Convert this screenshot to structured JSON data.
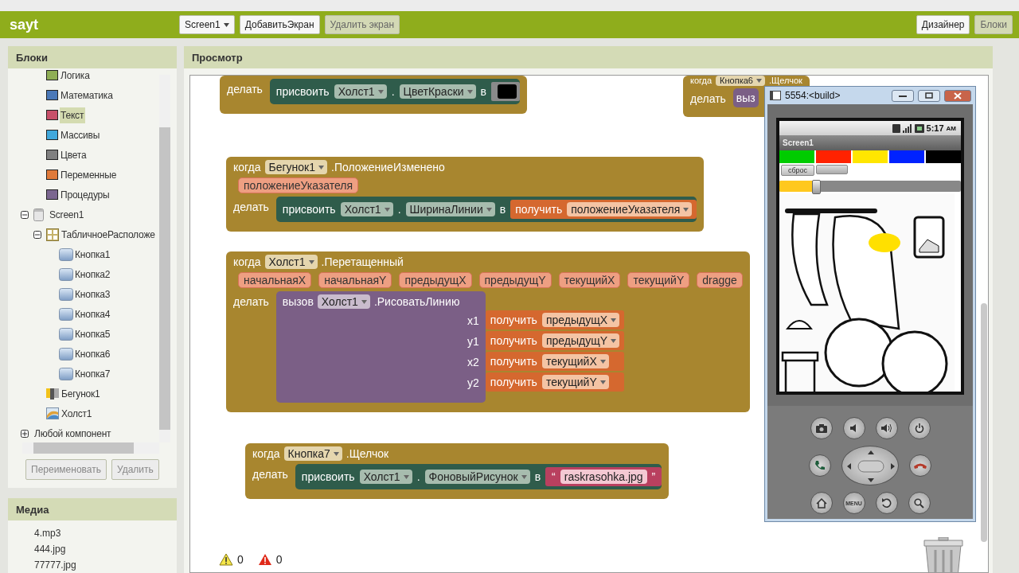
{
  "app_bar": {
    "title": "sayt",
    "screen_dropdown": "Screen1",
    "buttons": [
      {
        "label": "ДобавитьЭкран",
        "disabled": false
      },
      {
        "label": "Удалить экран",
        "disabled": true
      }
    ],
    "view_tabs": [
      {
        "label": "Дизайнер",
        "selected": false
      },
      {
        "label": "Блоки",
        "selected": true
      }
    ]
  },
  "blocks_panel": {
    "title": "Блоки",
    "tree": [
      {
        "kind": "builtin",
        "label": "Логика",
        "color": "#8fae55",
        "selected": false
      },
      {
        "kind": "builtin",
        "label": "Математика",
        "color": "#4a78b8",
        "selected": false
      },
      {
        "kind": "builtin",
        "label": "Текст",
        "color": "#c8506a",
        "selected": true
      },
      {
        "kind": "builtin",
        "label": "Массивы",
        "color": "#40a8dc",
        "selected": false
      },
      {
        "kind": "builtin",
        "label": "Цвета",
        "color": "#808080",
        "selected": false
      },
      {
        "kind": "builtin",
        "label": "Переменные",
        "color": "#e07a3a",
        "selected": false
      },
      {
        "kind": "builtin",
        "label": "Процедуры",
        "color": "#7b6690",
        "selected": false
      },
      {
        "kind": "screen",
        "label": "Screen1",
        "selected": false,
        "expanded": true,
        "children": [
          {
            "kind": "table",
            "label": "ТабличноеРасположе",
            "selected": false,
            "expanded": true,
            "children": [
              {
                "kind": "button",
                "label": "Кнопка1",
                "selected": false
              },
              {
                "kind": "button",
                "label": "Кнопка2",
                "selected": false
              },
              {
                "kind": "button",
                "label": "Кнопка3",
                "selected": false
              },
              {
                "kind": "button",
                "label": "Кнопка4",
                "selected": false
              },
              {
                "kind": "button",
                "label": "Кнопка5",
                "selected": false
              },
              {
                "kind": "button",
                "label": "Кнопка6",
                "selected": false
              },
              {
                "kind": "button",
                "label": "Кнопка7",
                "selected": false
              }
            ]
          },
          {
            "kind": "slider",
            "label": "Бегунок1",
            "selected": false
          },
          {
            "kind": "canvas",
            "label": "Холст1",
            "selected": false
          }
        ]
      },
      {
        "kind": "any",
        "label": "Любой компонент",
        "selected": false,
        "expanded": false
      }
    ],
    "buttons": [
      {
        "label": "Переименовать",
        "disabled": true
      },
      {
        "label": "Удалить",
        "disabled": true
      }
    ]
  },
  "media_panel": {
    "title": "Медиа",
    "files": [
      "4.mp3",
      "444.jpg",
      "77777.jpg"
    ]
  },
  "viewer": {
    "title": "Просмотр",
    "blocks": [
      {
        "kind": "event",
        "do": "делать",
        "statement": {
          "kind": "set",
          "verb": "присвоить",
          "component": "Холст1",
          "dot": ".",
          "property": "ЦветКраски",
          "to": "в",
          "value": {
            "kind": "color",
            "color": "#000000"
          }
        }
      },
      {
        "kind": "event",
        "when": "когда",
        "component": "Кнопка6",
        "event": ".Щелчок",
        "do": "делать",
        "statement": {
          "kind": "call",
          "verb": "выз"
        }
      },
      {
        "kind": "event",
        "when": "когда",
        "component": "Бегунок1",
        "event": ".ПоложениеИзменено",
        "params": [
          "положениеУказателя"
        ],
        "do": "делать",
        "statement": {
          "kind": "set",
          "verb": "присвоить",
          "component": "Холст1",
          "dot": ".",
          "property": "ШиринаЛинии",
          "to": "в",
          "value": {
            "kind": "get",
            "verb": "получить",
            "name": "положениеУказателя"
          }
        }
      },
      {
        "kind": "event",
        "when": "когда",
        "component": "Холст1",
        "event": ".Перетащенный",
        "params": [
          "начальнаяX",
          "начальнаяY",
          "предыдущX",
          "предыдущY",
          "текущийX",
          "текущийY",
          "dragge"
        ],
        "do": "делать",
        "statement": {
          "kind": "call",
          "verb": "вызов",
          "component": "Холст1",
          "method": ".РисоватьЛинию",
          "args": [
            {
              "name": "x1",
              "value": {
                "kind": "get",
                "verb": "получить",
                "name": "предыдущX"
              }
            },
            {
              "name": "y1",
              "value": {
                "kind": "get",
                "verb": "получить",
                "name": "предыдущY"
              }
            },
            {
              "name": "x2",
              "value": {
                "kind": "get",
                "verb": "получить",
                "name": "текущийX"
              }
            },
            {
              "name": "y2",
              "value": {
                "kind": "get",
                "verb": "получить",
                "name": "текущийY"
              }
            }
          ]
        }
      },
      {
        "kind": "event",
        "when": "когда",
        "component": "Кнопка7",
        "event": ".Щелчок",
        "do": "делать",
        "statement": {
          "kind": "set",
          "verb": "присвоить",
          "component": "Холст1",
          "dot": ".",
          "property": "ФоновыйРисунок",
          "to": "в",
          "value": {
            "kind": "text",
            "open": "“",
            "text": "raskrasohka.jpg",
            "close": "”"
          }
        }
      }
    ],
    "warnings": "0",
    "errors": "0"
  },
  "emulator": {
    "title": "5554:<build>",
    "time": "5:17",
    "am_pm": "AM",
    "app_title": "Screen1",
    "palette": [
      {
        "color": "#00cc00"
      },
      {
        "color": "#ff2200"
      },
      {
        "color": "#ffe600"
      },
      {
        "color": "#0022ff"
      },
      {
        "color": "#000000"
      }
    ],
    "buttons": [
      {
        "kind": "labeled",
        "label": "сброс"
      },
      {
        "kind": "blank"
      }
    ],
    "slider": {
      "level": 0.2
    },
    "menu_key": "MENU"
  }
}
